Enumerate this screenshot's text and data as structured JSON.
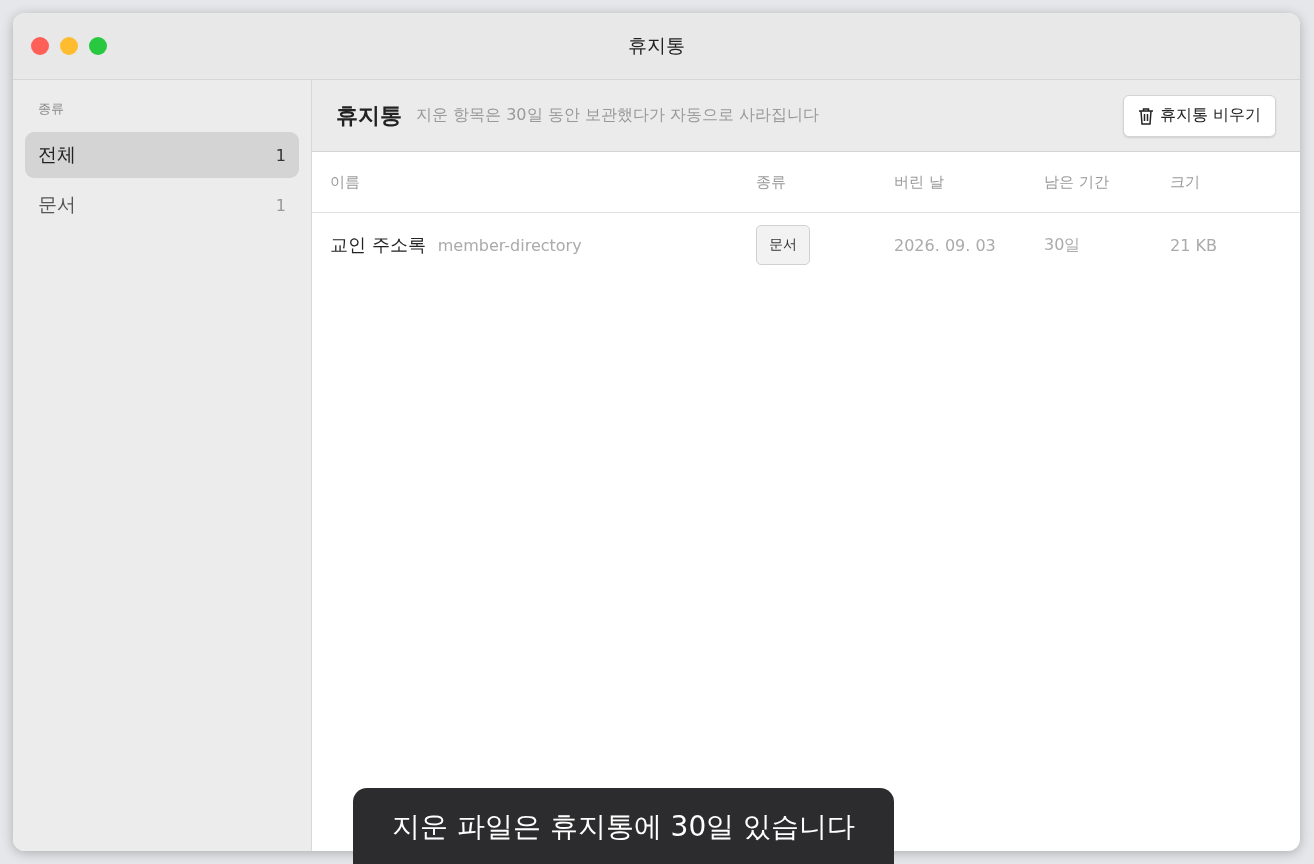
{
  "window": {
    "title": "휴지통"
  },
  "sidebar": {
    "heading": "종류",
    "items": [
      {
        "label": "전체",
        "count": "1",
        "selected": true
      },
      {
        "label": "문서",
        "count": "1",
        "selected": false
      }
    ]
  },
  "header": {
    "title": "휴지통",
    "subtitle": "지운 항목은 30일 동안 보관했다가 자동으로 사라집니다",
    "empty_button": "휴지통 비우기"
  },
  "table": {
    "columns": [
      "이름",
      "종류",
      "버린 날",
      "남은 기간",
      "크기"
    ],
    "rows": [
      {
        "name": "교인 주소록",
        "file": "member-directory",
        "type": "문서",
        "date": "2026. 09. 03",
        "remaining": "30일",
        "size": "21 KB"
      }
    ]
  },
  "toast": "지운 파일은 휴지통에 30일 있습니다"
}
